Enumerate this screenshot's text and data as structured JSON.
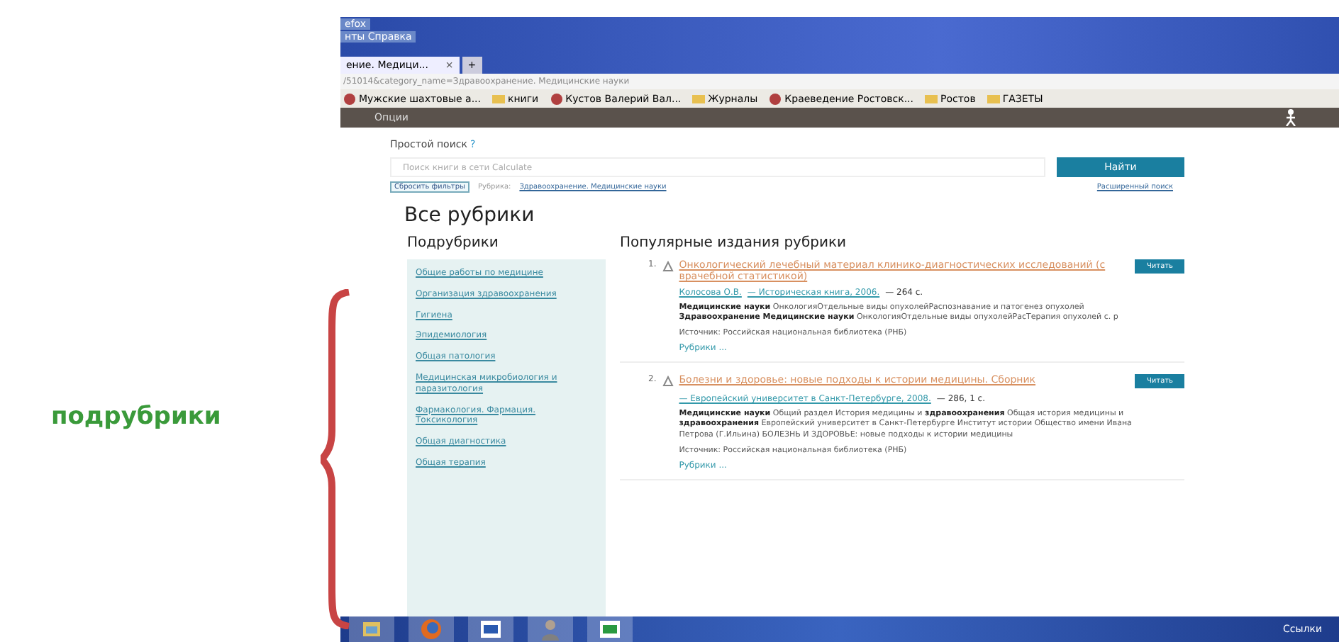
{
  "annotation": {
    "label": "подрубрики"
  },
  "browser": {
    "menu": [
      "efox",
      "нты Справка"
    ],
    "tab": {
      "title": "ение. Медици...",
      "close": "×",
      "new_tab": "+"
    },
    "url": "/51014&category_name=Здравоохранение. Медицинские науки",
    "bookmarks": [
      {
        "label": "Мужские шахтовые а...",
        "kind": "site"
      },
      {
        "label": "книги",
        "kind": "folder"
      },
      {
        "label": "Кустов Валерий Вал...",
        "kind": "site"
      },
      {
        "label": "Журналы",
        "kind": "folder"
      },
      {
        "label": "Краеведение Ростовск...",
        "kind": "site"
      },
      {
        "label": "Ростов",
        "kind": "folder"
      },
      {
        "label": "ГАЗЕТЫ",
        "kind": "folder"
      }
    ]
  },
  "site": {
    "nav": "Опции",
    "search": {
      "label": "Простой поиск",
      "help": "?",
      "placeholder": "Поиск книги в сети Calculate",
      "button": "Найти",
      "reset": "Сбросить фильтры",
      "filter_label": "Рубрика:",
      "filter_value": "Здравоохранение. Медицинские науки",
      "advanced": "Расширенный поиск"
    },
    "heading": "Все рубрики",
    "subrubrics_title": "Подрубрики",
    "subrubrics": [
      "Общие работы по медицине",
      "Организация здравоохранения",
      "Гигиена",
      "Эпидемиология",
      "Общая патология",
      "Медицинская микробиология и паразитология",
      "Фармакология. Фармация. Токсикология",
      "Общая диагностика",
      "Общая терапия"
    ],
    "popular_title": "Популярные издания рубрики",
    "items": [
      {
        "number": "1.",
        "title": "Онкологический лечебный материал клинико-диагностических исследований (с врачебной статистикой)",
        "author": "Колосова О.В.",
        "publisher": "— Историческая книга, 2006.",
        "pages": "— 264 с.",
        "description": "**Медицинские науки** ОнкологияОтдельные виды опухолейРаспознавание и патогенез опухолей **Здравоохранение Медицинские науки** ОнкологияОтдельные виды опухолейРасТерапия опухолей с. р",
        "source": "Источник: Российская национальная библиотека (РНБ)",
        "rubrics": "Рубрики ...",
        "button": "Читать"
      },
      {
        "number": "2.",
        "title": "Болезни и здоровье: новые подходы к истории медицины. Сборник",
        "publisher": "— Европейский университет в Санкт-Петербурге, 2008.",
        "pages": "— 286, 1 с.",
        "description": "**Медицинские науки** Общий раздел История медицины и **здравоохранения** Общая история медицины и **здравоохранения** Европейский университет в Санкт-Петербурге Институт истории Общество имени Ивана Петрова (Г.Ильина) БОЛЕЗНЬ И ЗДОРОВЬЕ: новые подходы к истории медицины",
        "source": "Источник: Российская национальная библиотека (РНБ)",
        "rubrics": "Рубрики ...",
        "button": "Читать"
      }
    ]
  },
  "taskbar": {
    "apps": [
      {
        "kind": "explorer"
      },
      {
        "kind": "firefox"
      },
      {
        "kind": "word"
      },
      {
        "kind": "person"
      },
      {
        "kind": "excel"
      }
    ],
    "links": "Ссылки"
  }
}
